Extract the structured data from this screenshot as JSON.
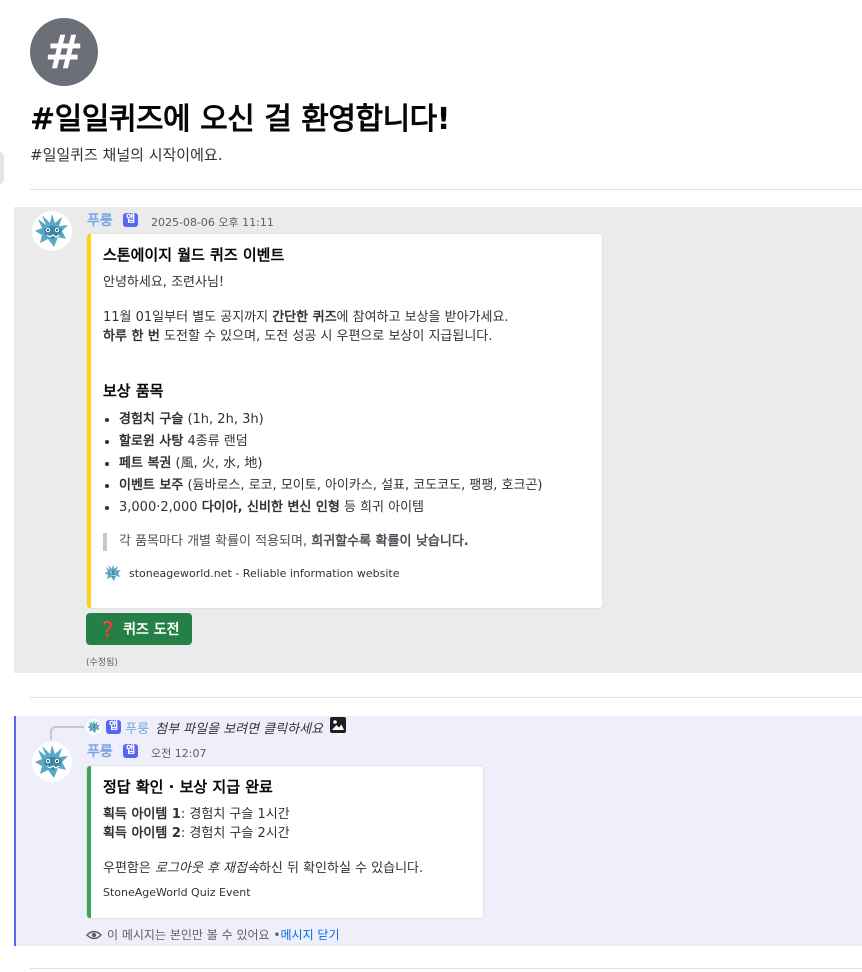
{
  "channel": {
    "hash_symbol": "#",
    "welcome_title": "#일일퀴즈에 오신 걸 환영합니다!",
    "welcome_subtitle": "#일일퀴즈 채널의 시작이에요."
  },
  "message1": {
    "author": "푸룽",
    "badge": "앱",
    "timestamp": "2025-08-06 오후 11:11",
    "edited_label": "(수정됨)",
    "embed": {
      "bar_color": "#fcd116",
      "title": "스톤에이지 월드 퀴즈 이벤트",
      "greeting": "안녕하세요, 조련사님!",
      "line1_a": "11월 01일부터 별도 공지까지 ",
      "line1_bold1": "간단한 퀴즈",
      "line1_b": "에 참여하고 보상을 받아가세요.",
      "line2_bold": "하루 한 번",
      "line2_rest": " 도전할 수 있으며, 도전 성공 시 우편으로 보상이 지급됩니다.",
      "rewards_heading": "보상 품목",
      "rewards": [
        {
          "bold": "경험치 구슬",
          "rest": " (1h, 2h, 3h)"
        },
        {
          "bold": "할로윈 사탕",
          "rest": " 4종류 랜덤"
        },
        {
          "bold": "페트 복권",
          "rest": " (風, 火, 水, 地)"
        },
        {
          "bold": "이벤트 보주",
          "rest": " (듐바로스, 로코, 모이토, 아이카스, 설표, 코도코도, 팽팽, 호크곤)"
        },
        {
          "pre": "3,000·2,000 ",
          "bold": "다이아, 신비한 변신 인형",
          "rest": " 등 희귀 아이템"
        }
      ],
      "quote_a": "각 품목마다 개별 확률이 적용되며, ",
      "quote_bold": "희귀할수록 확률이 낮습니다.",
      "footer": "stoneageworld.net - Reliable information website"
    },
    "button": {
      "icon": "❓",
      "label": "퀴즈 도전",
      "color": "#248046"
    }
  },
  "message2": {
    "reply": {
      "badge": "앱",
      "author": "푸룽",
      "text": "첨부 파일을 보려면 클릭하세요",
      "icon": "image-icon"
    },
    "author": "푸룽",
    "badge": "앱",
    "timestamp": "오전 12:07",
    "embed": {
      "bar_color": "#3ba55d",
      "title": "정답 확인 · 보상 지급 완료",
      "item1_label": "획득 아이템 1",
      "item1_value": ": 경험치 구슬 1시간",
      "item2_label": "획득 아이템 2",
      "item2_value": ": 경험치 구슬 2시간",
      "mail_a": "우편함은 ",
      "mail_italic": "로그아웃 후 재접속",
      "mail_b": "하신 뒤 확인하실 수 있습니다.",
      "footer": "StoneAgeWorld Quiz Event"
    },
    "ephemeral_note": "이 메시지는 본인만 볼 수 있어요 • ",
    "dismiss_link": "메시지 닫기"
  }
}
